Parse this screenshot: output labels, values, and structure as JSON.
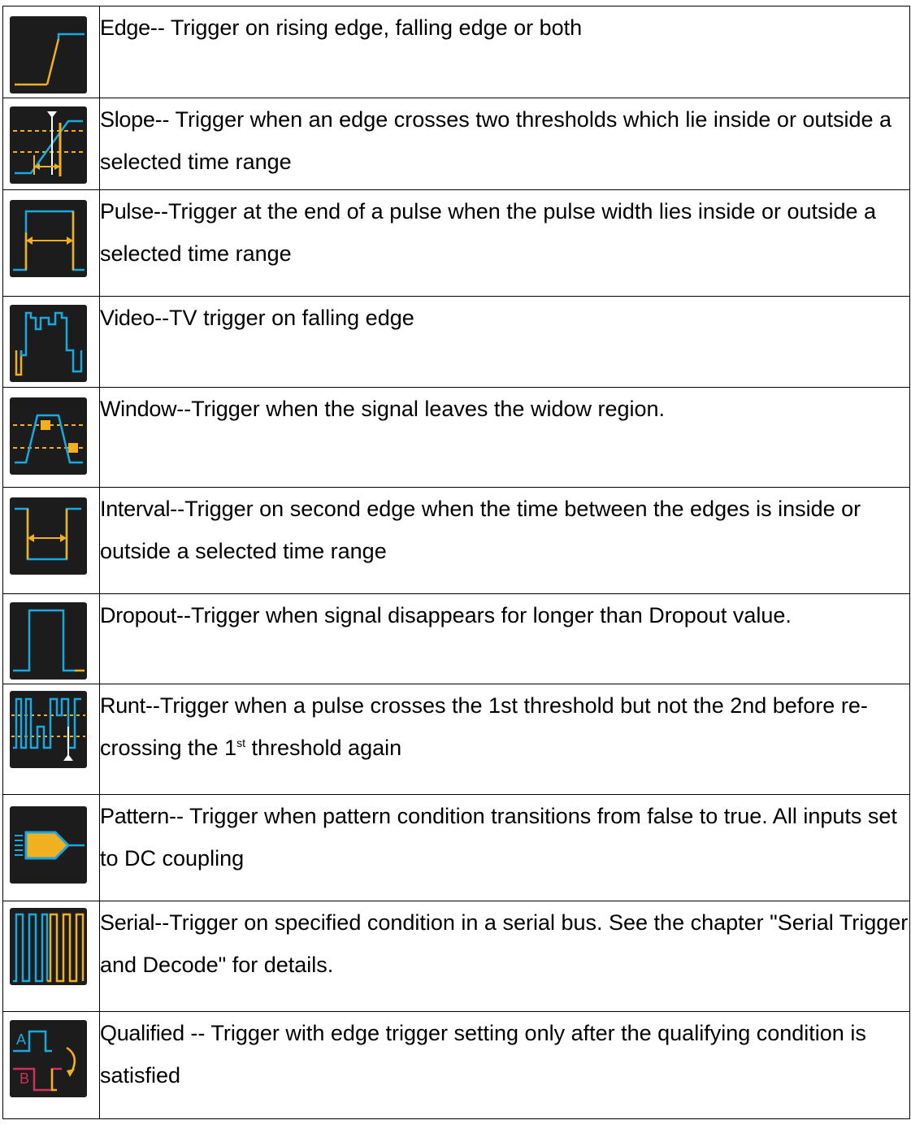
{
  "colors": {
    "icon_background": "#1c1c1c",
    "signal_blue": "#1aa8e0",
    "signal_yellow": "#f0b020",
    "signal_white": "#ffffff",
    "signal_pink": "#d0305a",
    "border": "#000000"
  },
  "triggers": [
    {
      "icon": "edge-trigger-icon",
      "keyword": "Edge",
      "text": "-- Trigger on rising edge, falling edge or both"
    },
    {
      "icon": "slope-trigger-icon",
      "keyword": "Slope",
      "text": "-- Trigger when an edge crosses two thresholds which lie inside or outside a selected time range"
    },
    {
      "icon": "pulse-trigger-icon",
      "keyword": "Pulse",
      "text": "--Trigger at the end of a pulse when the pulse width lies inside or outside a selected time range"
    },
    {
      "icon": "video-trigger-icon",
      "keyword": "Video",
      "text": "--TV trigger on falling edge"
    },
    {
      "icon": "window-trigger-icon",
      "keyword": "Window",
      "text": "--Trigger when the signal leaves the widow region."
    },
    {
      "icon": "interval-trigger-icon",
      "keyword": "Interval",
      "text": "--Trigger on second edge when the time between the edges is inside or outside a selected time range"
    },
    {
      "icon": "dropout-trigger-icon",
      "keyword": "Dropout",
      "text": "--Trigger when signal disappears for longer than Dropout value."
    },
    {
      "icon": "runt-trigger-icon",
      "keyword": "Runt",
      "text": "--Trigger when a pulse crosses the 1st threshold but not the 2nd before re-crossing the 1",
      "superscript": "st",
      "text_after": " threshold again"
    },
    {
      "icon": "pattern-trigger-icon",
      "keyword": "Pattern",
      "text": "-- Trigger when pattern condition transitions from false to true. All inputs set to DC coupling"
    },
    {
      "icon": "serial-trigger-icon",
      "keyword": "Serial",
      "text": "--Trigger on specified condition in a serial bus. See the chapter \"Serial Trigger and Decode\" for details."
    },
    {
      "icon": "qualified-trigger-icon",
      "keyword": "Qualified",
      "text": " -- Trigger with edge trigger setting only after the qualifying condition is satisfied",
      "icon_labels": [
        "A",
        "B"
      ]
    }
  ]
}
